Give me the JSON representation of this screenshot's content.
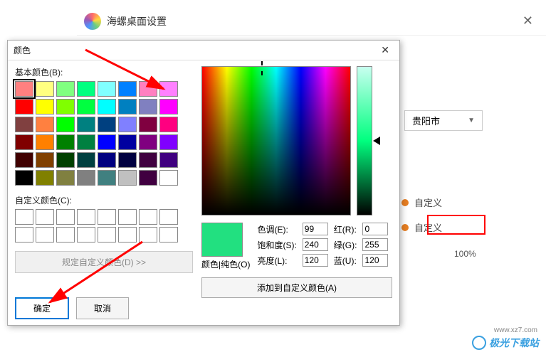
{
  "main_window": {
    "title": "海螺桌面设置",
    "dropdown_city": "贵阳市",
    "option_label": "自定义",
    "percent": "100%"
  },
  "color_dialog": {
    "title": "颜色",
    "basic_label": "基本颜色(B):",
    "custom_label": "自定义颜色(C):",
    "define_button": "规定自定义颜色(D) >>",
    "ok": "确定",
    "cancel": "取消",
    "preview_label": "颜色|纯色(O)",
    "hue_label": "色调(E):",
    "sat_label": "饱和度(S):",
    "lum_label": "亮度(L):",
    "red_label": "红(R):",
    "green_label": "绿(G):",
    "blue_label": "蓝(U):",
    "hue": "99",
    "sat": "240",
    "lum": "120",
    "red": "0",
    "green": "255",
    "blue": "120",
    "add_custom": "添加到自定义颜色(A)",
    "basic_colors": [
      "#ff8080",
      "#ffff80",
      "#80ff80",
      "#00ff80",
      "#80ffff",
      "#0080ff",
      "#ff80c0",
      "#ff80ff",
      "#ff0000",
      "#ffff00",
      "#80ff00",
      "#00ff40",
      "#00ffff",
      "#0080c0",
      "#8080c0",
      "#ff00ff",
      "#804040",
      "#ff8040",
      "#00ff00",
      "#008080",
      "#004080",
      "#8080ff",
      "#800040",
      "#ff0080",
      "#800000",
      "#ff8000",
      "#008000",
      "#008040",
      "#0000ff",
      "#0000a0",
      "#800080",
      "#8000ff",
      "#400000",
      "#804000",
      "#004000",
      "#004040",
      "#000080",
      "#000040",
      "#400040",
      "#400080",
      "#000000",
      "#808000",
      "#808040",
      "#808080",
      "#408080",
      "#c0c0c0",
      "#400040",
      "#ffffff"
    ],
    "selected_index": 0
  },
  "watermark": {
    "text": "极光下载站",
    "url": "www.xz7.com"
  }
}
